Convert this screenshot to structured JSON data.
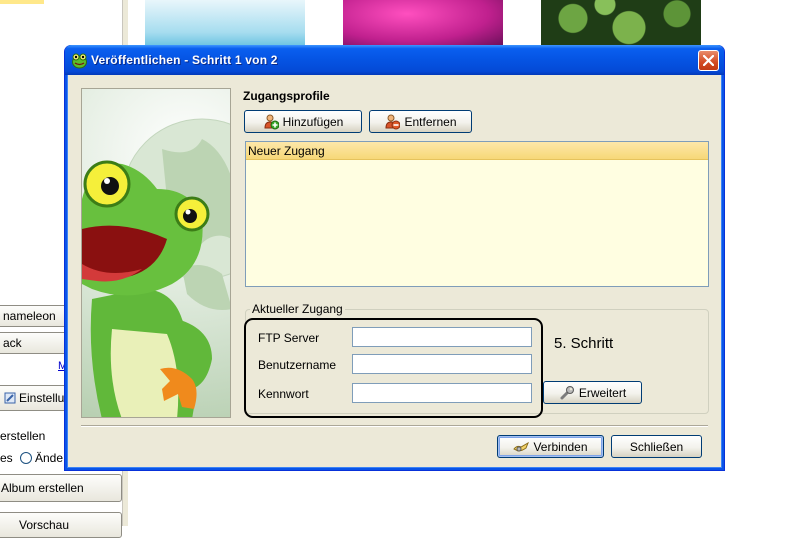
{
  "background": {
    "left_buttons": [
      {
        "label": "nameleon"
      },
      {
        "label": "ack"
      },
      {
        "label": "Einstellun"
      },
      {
        "label": "Album erstellen"
      },
      {
        "label": "Vorschau"
      }
    ],
    "link_text": "M",
    "section_label": "erstellen",
    "radio_prefix": "es",
    "radio_label": "Ände"
  },
  "dialog": {
    "title": "Veröffentlichen - Schritt 1 von 2",
    "profiles_heading": "Zugangsprofile",
    "add_button": "Hinzufügen",
    "remove_button": "Entfernen",
    "profiles": [
      {
        "name": "Neuer Zugang",
        "selected": true
      }
    ],
    "current_access_legend": "Aktueller Zugang",
    "ftp_server_label": "FTP Server",
    "ftp_server_value": "",
    "username_label": "Benutzername",
    "username_value": "",
    "password_label": "Kennwort",
    "password_value": "",
    "step_text": "5. Schritt",
    "advanced_button": "Erweitert",
    "connect_button": "Verbinden",
    "close_button": "Schließen"
  },
  "colors": {
    "titlebar": "#0554e3",
    "dialog_face": "#ece9d8",
    "list_background": "#fffee1",
    "selected_row": "#f7d878"
  }
}
